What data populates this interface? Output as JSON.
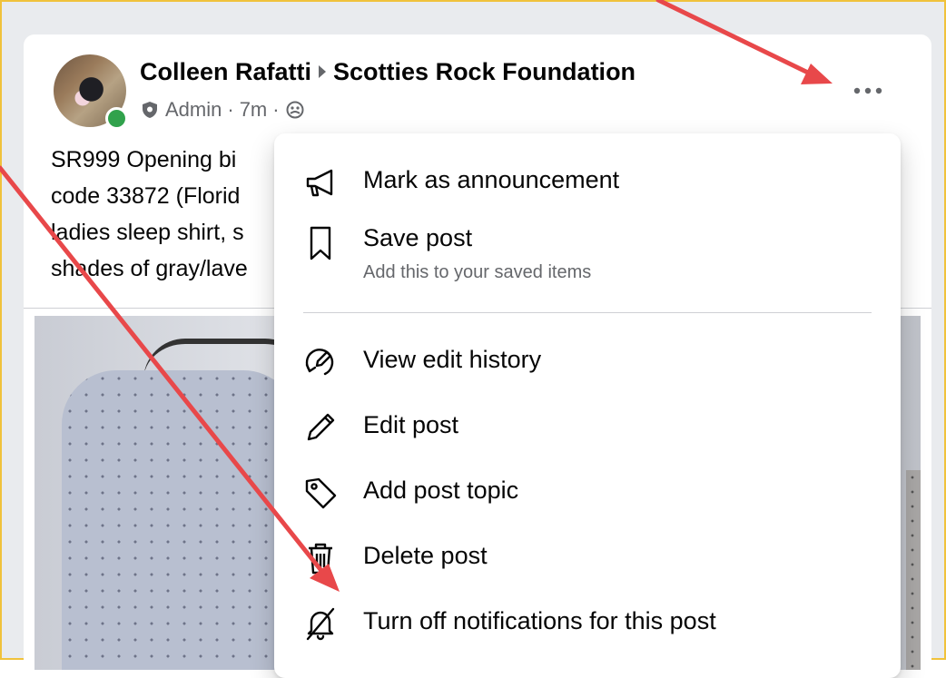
{
  "post": {
    "author": "Colleen Rafatti",
    "group": "Scotties Rock Foundation",
    "role": "Admin",
    "time": "7m",
    "text_lines": [
      "SR999  Opening bi",
      "code 33872 (Florid",
      "ladies sleep shirt, s",
      "shades of gray/lave"
    ]
  },
  "menu": {
    "items": [
      {
        "label": "Mark as announcement",
        "icon": "megaphone-icon"
      },
      {
        "label": "Save post",
        "sublabel": "Add this to your saved items",
        "icon": "bookmark-icon"
      },
      {
        "label": "View edit history",
        "icon": "edit-history-icon"
      },
      {
        "label": "Edit post",
        "icon": "pencil-icon"
      },
      {
        "label": "Add post topic",
        "icon": "tag-icon"
      },
      {
        "label": "Delete post",
        "icon": "trash-icon"
      },
      {
        "label": "Turn off notifications for this post",
        "icon": "bell-off-icon"
      }
    ]
  },
  "colors": {
    "annotation_arrow": "#e8484a",
    "frame_border": "#f0c23b",
    "online": "#31a24c"
  }
}
